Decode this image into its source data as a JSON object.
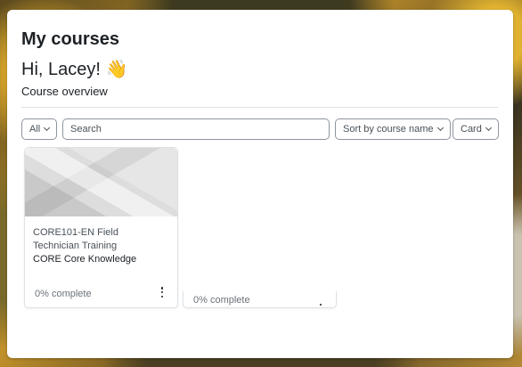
{
  "header": {
    "title": "My courses",
    "greeting": "Hi, Lacey! 👋",
    "section": "Course overview"
  },
  "filters": {
    "grouping": "All",
    "search_placeholder": "Search",
    "sort": "Sort by course name",
    "view": "Card"
  },
  "courses": [
    {
      "name": "CORE101-EN Field Technician Training",
      "category": "CORE Core Knowledge",
      "progress_text": "0% complete",
      "progress": 0
    },
    {
      "progress_text": "0% complete",
      "progress": 0
    }
  ],
  "colors": {
    "panel": "#ffffff",
    "text": "#1d2125",
    "muted": "#6a737b",
    "border": "#8f959e"
  }
}
